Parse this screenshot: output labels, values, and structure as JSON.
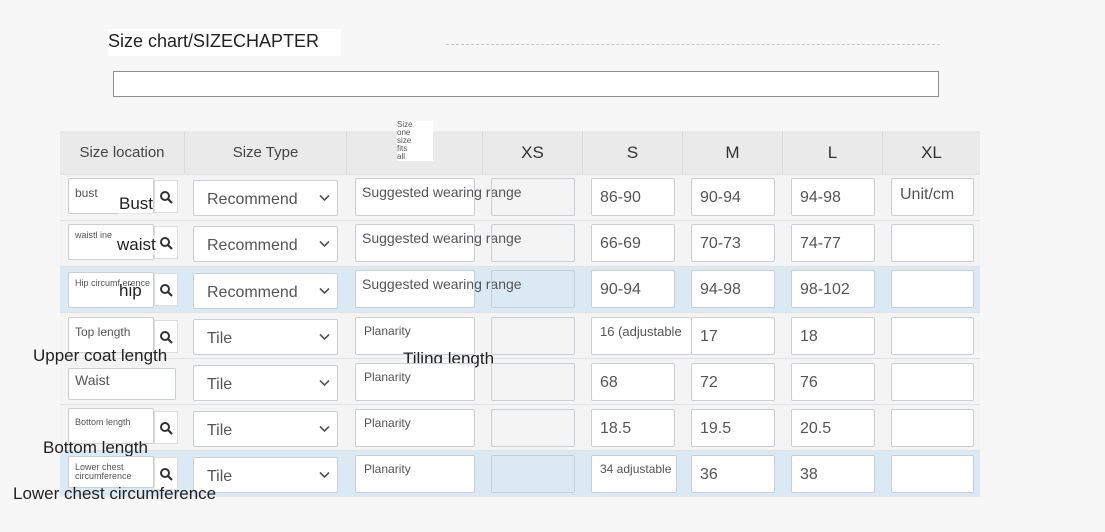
{
  "title": "Size chart/SIZECHAPTER",
  "header": {
    "size_location": "Size location",
    "size_type": "Size Type",
    "one_size": [
      "Size",
      "one",
      "size",
      "fits",
      "all"
    ],
    "sizes": [
      "XS",
      "S",
      "M",
      "L",
      "XL"
    ]
  },
  "rows": [
    {
      "loc": "bust",
      "overlay": "Bust",
      "type": "Recommend",
      "desc": "Suggested wearing range",
      "xs": "",
      "s": "86-90",
      "m": "90-94",
      "l": "94-98",
      "xl": "Unit/cm"
    },
    {
      "loc": "waistl ine",
      "overlay": "waist",
      "type": "Recommend",
      "desc": "Suggested wearing range",
      "xs": "",
      "s": "66-69",
      "m": "70-73",
      "l": "74-77",
      "xl": ""
    },
    {
      "loc": "Hip circumf erence",
      "overlay": "hip",
      "type": "Recommend",
      "desc": "Suggested wearing range",
      "xs": "",
      "s": "90-94",
      "m": "94-98",
      "l": "98-102",
      "xl": ""
    },
    {
      "loc": "Top length",
      "overlay": "Upper coat length",
      "type": "Tile",
      "desc": "Planarity",
      "xs": "",
      "s": "16 (adjustable",
      "m": "17",
      "l": "18",
      "xl": ""
    },
    {
      "loc": "Waist",
      "overlay": "",
      "type": "Tile",
      "desc": "Planarity",
      "xs": "",
      "s": "68",
      "m": "72",
      "l": "76",
      "xl": ""
    },
    {
      "loc": "Bottom length",
      "overlay": "Bottom length",
      "type": "Tile",
      "desc": "Planarity",
      "xs": "",
      "s": "18.5",
      "m": "19.5",
      "l": "20.5",
      "xl": ""
    },
    {
      "loc": "Lower chest circumference",
      "overlay": "Lower chest circumference",
      "type": "Tile",
      "desc": "Planarity",
      "xs": "",
      "s": "34 adjustable",
      "m": "36",
      "l": "38",
      "xl": ""
    }
  ],
  "tiling_label": "Tiling length",
  "colors": {
    "blue_row": "#dbe9f4",
    "header": "#ececec"
  }
}
